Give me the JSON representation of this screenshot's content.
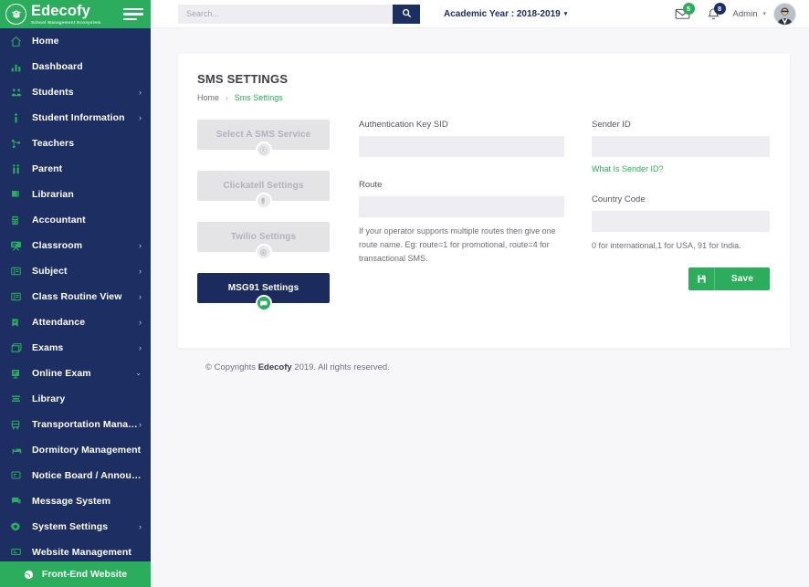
{
  "brand": {
    "name": "Edecofy",
    "tagline": "School Management Ecosystem",
    "logo_icon": "graduation-seal-icon",
    "menu_icon": "hamburger-icon",
    "green": "#2bad5d",
    "navy": "#1d2e62"
  },
  "sidebar": {
    "items": [
      {
        "label": "Home",
        "icon": "home-icon",
        "caret": "",
        "active": false
      },
      {
        "label": "Dashboard",
        "icon": "chart-bar-icon",
        "caret": "",
        "active": false
      },
      {
        "label": "Students",
        "icon": "students-icon",
        "caret": "›",
        "active": false
      },
      {
        "label": "Student Information",
        "icon": "info-icon",
        "caret": "›",
        "active": false
      },
      {
        "label": "Teachers",
        "icon": "teachers-icon",
        "caret": "",
        "active": false
      },
      {
        "label": "Parent",
        "icon": "parent-icon",
        "caret": "",
        "active": false
      },
      {
        "label": "Librarian",
        "icon": "librarian-icon",
        "caret": "",
        "active": false
      },
      {
        "label": "Accountant",
        "icon": "accountant-icon",
        "caret": "",
        "active": false
      },
      {
        "label": "Classroom",
        "icon": "classroom-icon",
        "caret": "›",
        "active": false
      },
      {
        "label": "Subject",
        "icon": "subject-icon",
        "caret": "›",
        "active": false
      },
      {
        "label": "Class Routine View",
        "icon": "routine-icon",
        "caret": "›",
        "active": false
      },
      {
        "label": "Attendance",
        "icon": "attendance-icon",
        "caret": "›",
        "active": false
      },
      {
        "label": "Exams",
        "icon": "exams-icon",
        "caret": "›",
        "active": false
      },
      {
        "label": "Online Exam",
        "icon": "online-exam-icon",
        "caret": "⌄",
        "active": false
      },
      {
        "label": "Library",
        "icon": "library-icon",
        "caret": "",
        "active": false
      },
      {
        "label": "Transportation Manage...",
        "icon": "bus-icon",
        "caret": "›",
        "active": false
      },
      {
        "label": "Dormitory Management",
        "icon": "bed-icon",
        "caret": "",
        "active": false
      },
      {
        "label": "Notice Board / Announ...",
        "icon": "notice-board-icon",
        "caret": "",
        "active": false
      },
      {
        "label": "Message System",
        "icon": "message-icon",
        "caret": "",
        "active": false
      },
      {
        "label": "System Settings",
        "icon": "gear-icon",
        "caret": "›",
        "active": false
      },
      {
        "label": "Website Management",
        "icon": "monitor-icon",
        "caret": "",
        "active": false
      }
    ],
    "frontend": {
      "label": "Front-End Website",
      "icon": "globe-icon"
    }
  },
  "topbar": {
    "search": {
      "placeholder": "Search...",
      "value": "",
      "icon": "search-icon"
    },
    "academic_year": {
      "label": "Academic Year : 2018-2019",
      "caret": "▾"
    },
    "messages": {
      "icon": "envelope-icon",
      "count": "5",
      "badge_color": "#2bad5d"
    },
    "notifications": {
      "icon": "bell-icon",
      "count": "8",
      "badge_color": "#1d2e62"
    },
    "user": {
      "label": "Admin",
      "caret": "▾",
      "avatar_icon": "avatar-icon"
    }
  },
  "card": {
    "title": "SMS SETTINGS",
    "breadcrumb": {
      "home": "Home",
      "separator": "›",
      "current": "Sms Settings"
    },
    "services": [
      {
        "label": "Select A SMS Service",
        "icon": "select-service-icon",
        "active": false
      },
      {
        "label": "Clickatell Settings",
        "icon": "clickatell-icon",
        "active": false
      },
      {
        "label": "Twilio Settings",
        "icon": "twilio-icon",
        "active": false
      },
      {
        "label": "MSG91 Settings",
        "icon": "comment-icon",
        "active": true
      }
    ],
    "fields": {
      "auth_key": {
        "label": "Authentication Key SID",
        "value": "",
        "placeholder": ""
      },
      "route": {
        "label": "Route",
        "value": "",
        "placeholder": "",
        "help": "If your operator supports multiple routes then give one route name. Eg: route=1 for promotional, route=4 for transactional SMS."
      },
      "sender_id": {
        "label": "Sender ID",
        "value": "",
        "placeholder": "",
        "link": "What Is Sender ID?"
      },
      "country_code": {
        "label": "Country Code",
        "value": "",
        "placeholder": "",
        "help": "0 for international,1 for USA, 91 for India."
      }
    },
    "save": {
      "label": "Save",
      "icon": "save-icon"
    }
  },
  "footer": {
    "prefix": "© Copyrights ",
    "brand": "Edecofy",
    "suffix": " 2019. All rights reserved."
  }
}
